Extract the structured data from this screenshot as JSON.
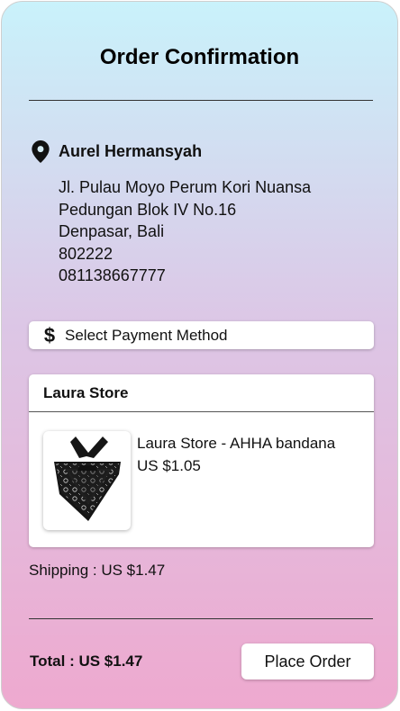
{
  "header": {
    "title": "Order Confirmation"
  },
  "address": {
    "name": "Aurel Hermansyah",
    "lines": [
      "Jl. Pulau Moyo Perum Kori Nuansa",
      "Pedungan Blok IV No.16",
      "Denpasar, Bali",
      "802222",
      "081138667777"
    ]
  },
  "payment": {
    "icon": "dollar-icon",
    "symbol": "$",
    "label": "Select Payment Method"
  },
  "store": {
    "name": "Laura Store",
    "product": {
      "name": "Laura Store - AHHA bandana",
      "price": "US $1.05"
    }
  },
  "shipping": "Shipping : US $1.47",
  "total": "Total : US $1.47",
  "actions": {
    "place_order_label": "Place Order"
  }
}
